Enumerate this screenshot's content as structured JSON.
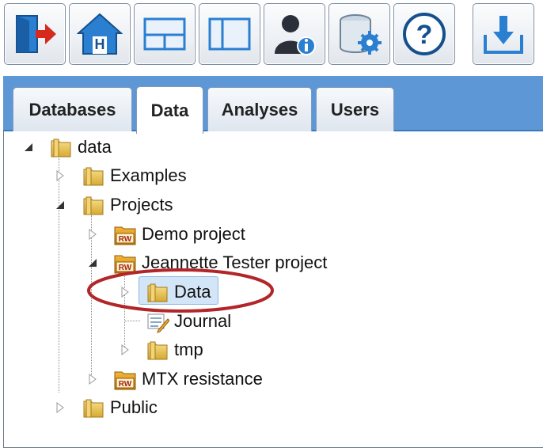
{
  "toolbar": {
    "buttons": [
      {
        "name": "logout",
        "icon": "exit-door-icon"
      },
      {
        "name": "home",
        "icon": "home-icon"
      },
      {
        "name": "layout-split",
        "icon": "split-layout-icon"
      },
      {
        "name": "layout-sidebar",
        "icon": "sidebar-layout-icon"
      },
      {
        "name": "user-info",
        "icon": "user-info-icon"
      },
      {
        "name": "database-settings",
        "icon": "database-gear-icon"
      },
      {
        "name": "help",
        "icon": "help-icon"
      },
      {
        "name": "import",
        "icon": "import-tray-icon"
      }
    ]
  },
  "tabs": [
    {
      "label": "Databases",
      "active": false
    },
    {
      "label": "Data",
      "active": true
    },
    {
      "label": "Analyses",
      "active": false
    },
    {
      "label": "Users",
      "active": false
    }
  ],
  "tree": {
    "root": "data",
    "examples": "Examples",
    "projects": "Projects",
    "demo_project": "Demo project",
    "tester_project": "Jeannette Tester project",
    "tester_data": "Data",
    "tester_journal": "Journal",
    "tester_tmp": "tmp",
    "mtx": "MTX resistance",
    "public": "Public"
  },
  "badges": {
    "project_badge": "RW"
  },
  "colors": {
    "tab_strip": "#5e97d6",
    "selection": "#d3e6f8",
    "highlight_ring": "#b2262a",
    "folder": "#e8c55a",
    "toolbar_icon": "#2476c9"
  }
}
